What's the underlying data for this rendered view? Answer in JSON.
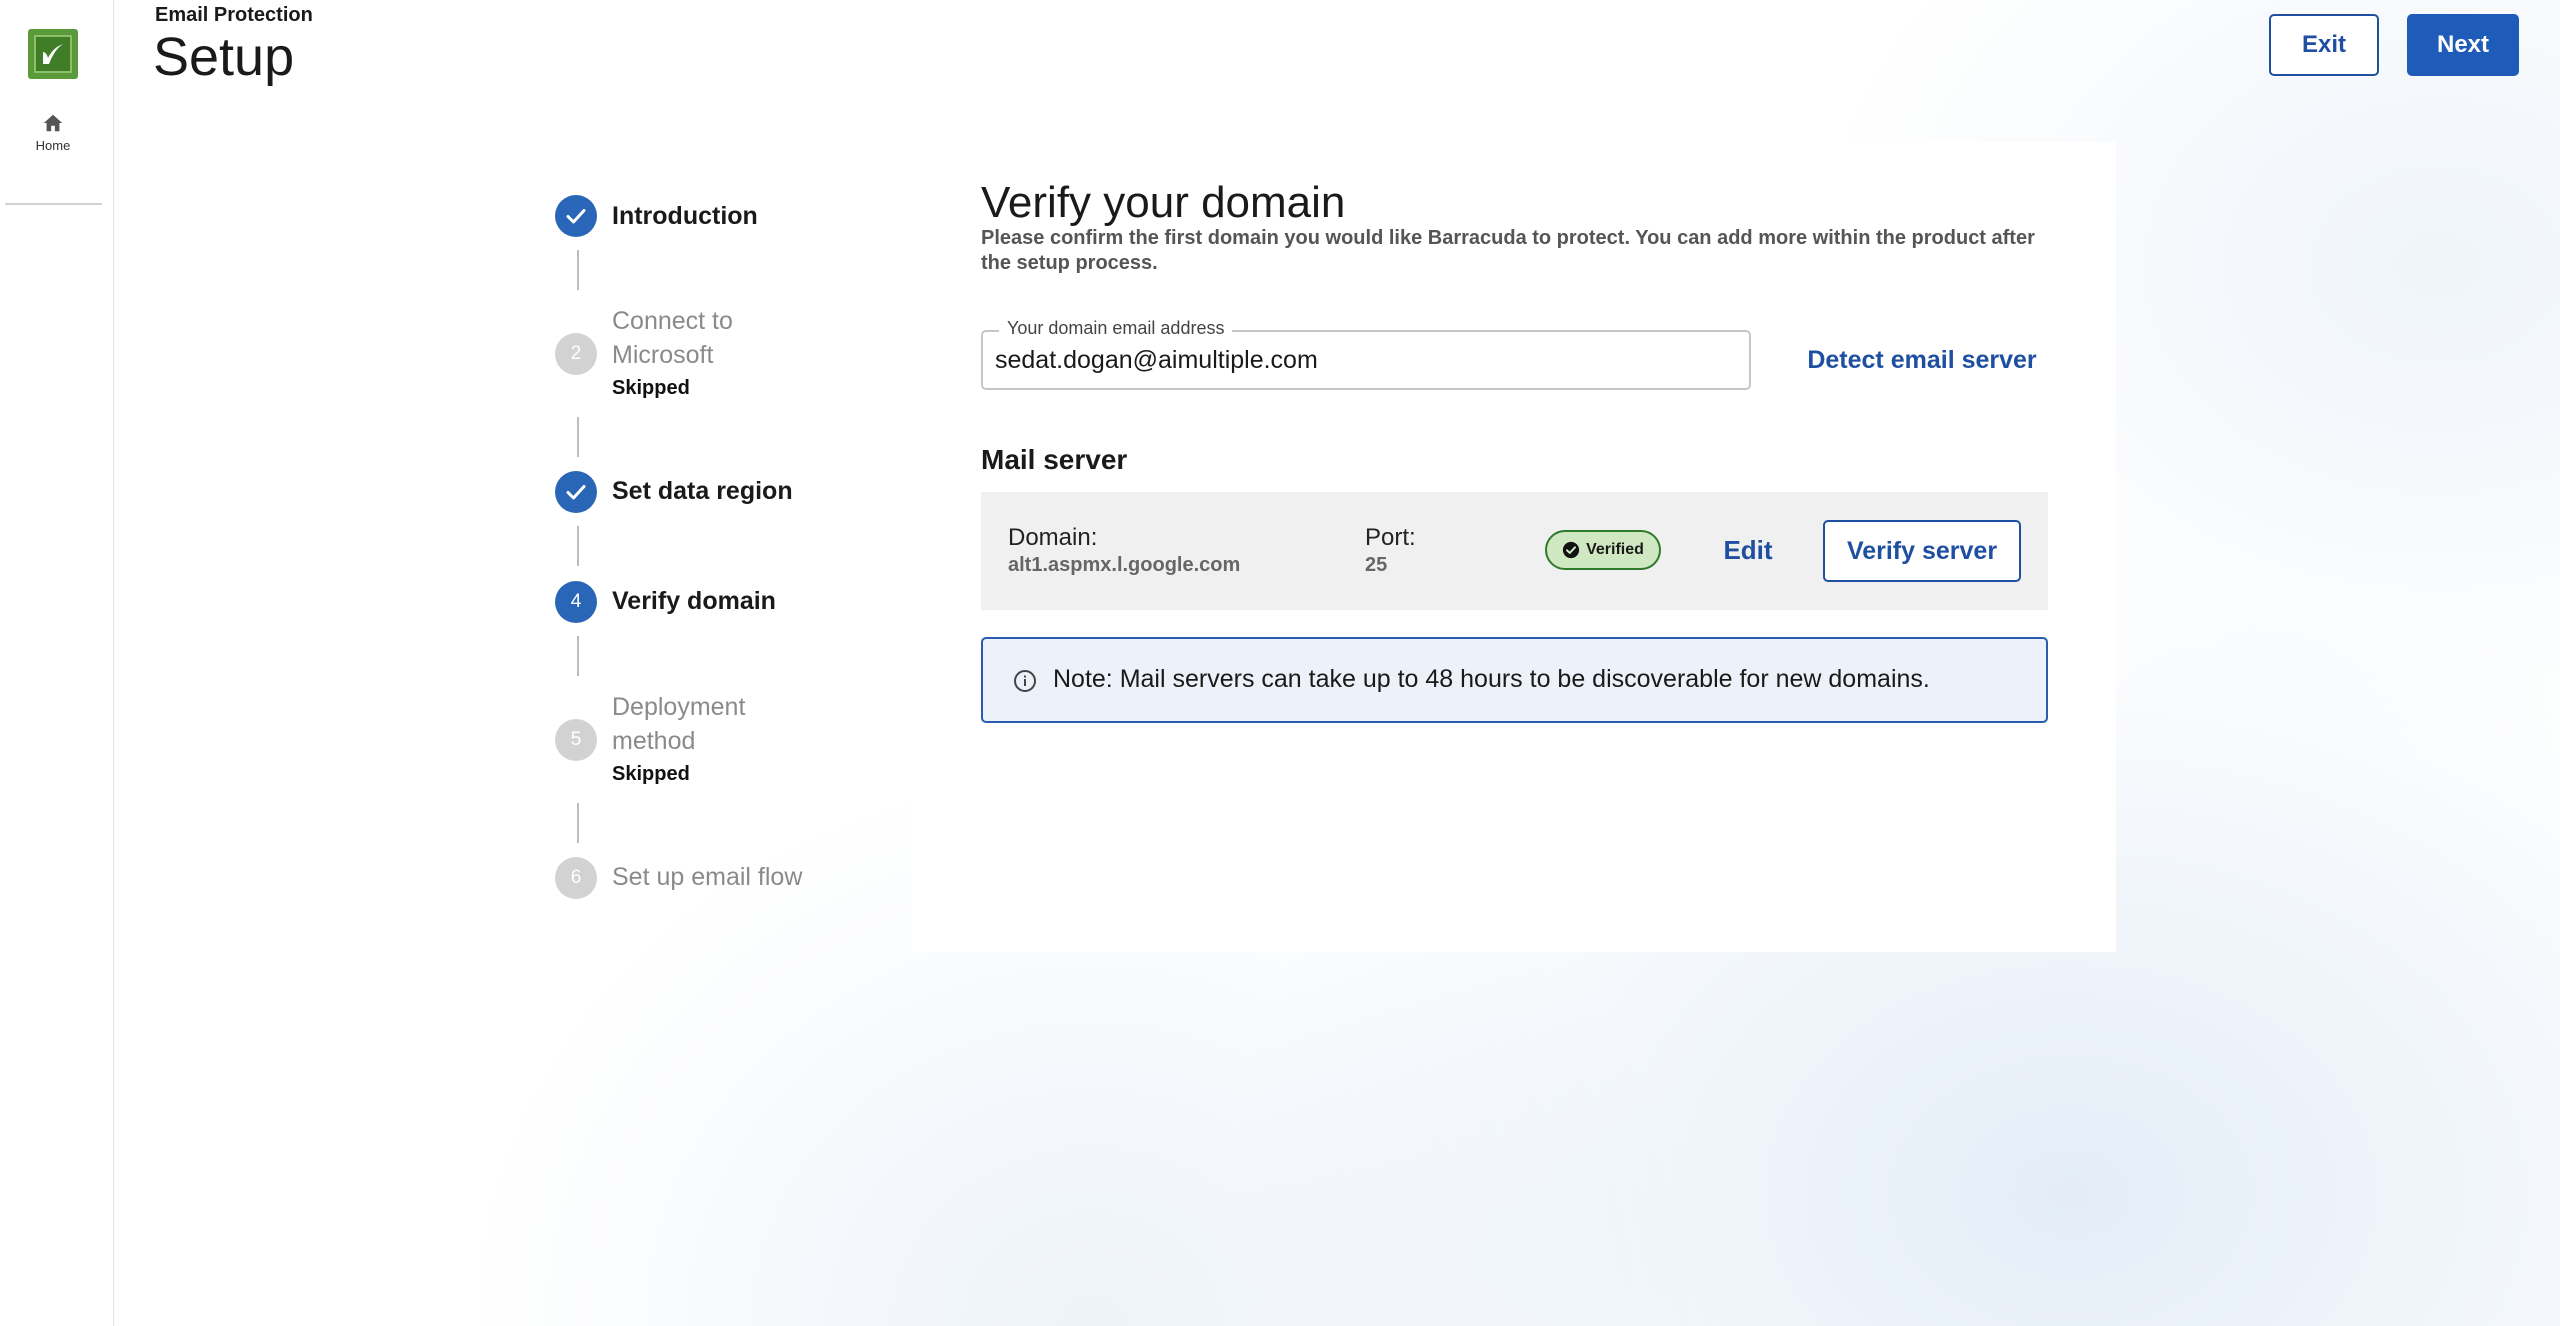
{
  "app": {
    "subtitle": "Email Protection",
    "title": "Setup"
  },
  "sidebar": {
    "home_label": "Home"
  },
  "header_actions": {
    "exit_label": "Exit",
    "next_label": "Next"
  },
  "stepper": {
    "steps": [
      {
        "number": "1",
        "label": "Introduction",
        "status": "done",
        "sub": ""
      },
      {
        "number": "2",
        "label": "Connect to Microsoft",
        "label_line1": "Connect to",
        "label_line2": "Microsoft",
        "status": "skipped",
        "sub": "Skipped"
      },
      {
        "number": "3",
        "label": "Set data region",
        "status": "done",
        "sub": ""
      },
      {
        "number": "4",
        "label": "Verify domain",
        "status": "active",
        "sub": ""
      },
      {
        "number": "5",
        "label": "Deployment method",
        "label_line1": "Deployment",
        "label_line2": "method",
        "status": "skipped",
        "sub": "Skipped"
      },
      {
        "number": "6",
        "label": "Set up email flow",
        "status": "pending",
        "sub": ""
      }
    ]
  },
  "main": {
    "title": "Verify your domain",
    "description": "Please confirm the first domain you would like Barracuda to protect. You can add more within the product after the setup process.",
    "email_field": {
      "label": "Your domain email address",
      "value": "sedat.dogan@aimultiple.com"
    },
    "detect_label": "Detect email server",
    "mail_server": {
      "heading": "Mail server",
      "domain_label": "Domain:",
      "domain_value": "alt1.aspmx.l.google.com",
      "port_label": "Port:",
      "port_value": "25",
      "status_badge": "Verified",
      "edit_label": "Edit",
      "verify_label": "Verify server"
    },
    "note": "Note: Mail servers can take up to 48 hours to be discoverable for new domains."
  },
  "colors": {
    "accent": "#1f5bb8",
    "step_done": "#2a66b8",
    "step_skipped": "#d2d2d2",
    "verified_bg": "#cfe8c1",
    "logo_green": "#5a9a3a"
  },
  "icons": {
    "logo": "barracuda-logo-icon",
    "home": "home-icon",
    "check": "check-icon",
    "info": "info-icon",
    "verified": "check-circle-icon"
  }
}
